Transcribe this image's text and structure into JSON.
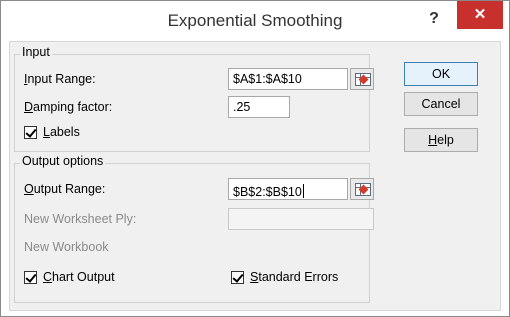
{
  "dialog": {
    "title": "Exponential Smoothing",
    "help_symbol": "?",
    "close_symbol": "✕"
  },
  "input_group": {
    "label": "Input",
    "input_range_label": "Input Range:",
    "input_range_value": "$A$1:$A$10",
    "damping_label": "Damping factor:",
    "damping_value": ".25",
    "labels_checkbox": {
      "label": "Labels",
      "checked": true
    }
  },
  "output_group": {
    "label": "Output options",
    "output_range_label": "Output Range:",
    "output_range_value": "$B$2:$B$10",
    "new_worksheet_label": "New Worksheet Ply:",
    "new_worksheet_value": "",
    "new_workbook_label": "New Workbook",
    "chart_output": {
      "label": "Chart Output",
      "checked": true
    },
    "standard_errors": {
      "label": "Standard Errors",
      "checked": true
    }
  },
  "buttons": {
    "ok": "OK",
    "cancel": "Cancel",
    "help": "Help"
  },
  "icons": {
    "range_selector": "collapse-dialog-icon"
  },
  "colors": {
    "close_button": "#c7302c",
    "ok_border": "#3c7fb1"
  }
}
